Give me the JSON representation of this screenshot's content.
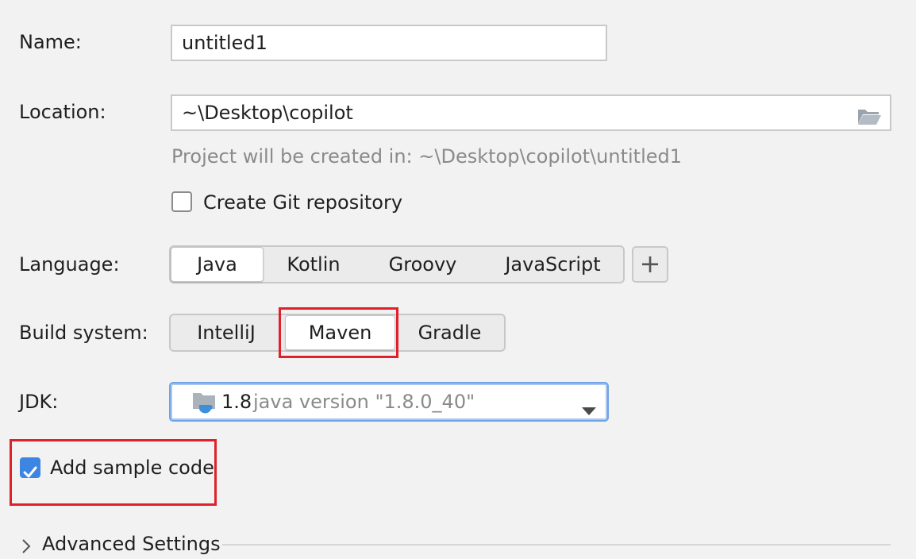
{
  "form": {
    "name_label": "Name:",
    "name_value": "untitled1",
    "location_label": "Location:",
    "location_value": "~\\Desktop\\copilot",
    "location_hint": "Project will be created in: ~\\Desktop\\copilot\\untitled1",
    "git_checkbox_label": "Create Git repository",
    "git_checked": false,
    "language_label": "Language:",
    "languages": [
      "Java",
      "Kotlin",
      "Groovy",
      "JavaScript"
    ],
    "language_selected": "Java",
    "add_language_label": "+",
    "build_label": "Build system:",
    "build_systems": [
      "IntelliJ",
      "Maven",
      "Gradle"
    ],
    "build_selected": "Maven",
    "jdk_label": "JDK:",
    "jdk_version": "1.8",
    "jdk_detail": "java version \"1.8.0_40\"",
    "sample_code_label": "Add sample code",
    "sample_code_checked": true,
    "advanced_label": "Advanced Settings"
  },
  "icons": {
    "folder": "folder-open-icon",
    "jdk": "jdk-folder-icon",
    "dropdown": "chevron-down-icon",
    "expand": "chevron-right-icon",
    "check": "checkmark-icon"
  },
  "colors": {
    "accent": "#3d85e3",
    "highlight_box": "#e0202a",
    "hint_text": "#8a8a8a"
  }
}
